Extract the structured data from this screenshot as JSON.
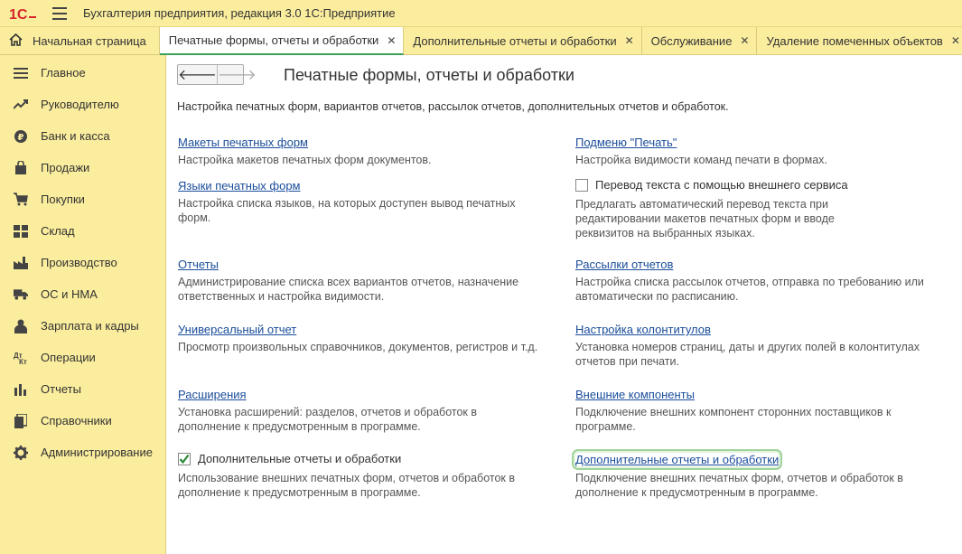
{
  "app": {
    "title": "Бухгалтерия предприятия, редакция 3.0 1С:Предприятие"
  },
  "tabs": [
    {
      "label": "Начальная страница"
    },
    {
      "label": "Печатные формы, отчеты и обработки"
    },
    {
      "label": "Дополнительные отчеты и обработки"
    },
    {
      "label": "Обслуживание"
    },
    {
      "label": "Удаление помеченных объектов"
    }
  ],
  "sidebar": {
    "items": [
      {
        "label": "Главное",
        "icon": "menu-lines-icon"
      },
      {
        "label": "Руководителю",
        "icon": "trend-icon"
      },
      {
        "label": "Банк и касса",
        "icon": "ruble-coin-icon"
      },
      {
        "label": "Продажи",
        "icon": "shopping-bag-icon"
      },
      {
        "label": "Покупки",
        "icon": "cart-icon"
      },
      {
        "label": "Склад",
        "icon": "warehouse-icon"
      },
      {
        "label": "Производство",
        "icon": "factory-icon"
      },
      {
        "label": "ОС и НМА",
        "icon": "truck-icon"
      },
      {
        "label": "Зарплата и кадры",
        "icon": "person-icon"
      },
      {
        "label": "Операции",
        "icon": "debit-credit-icon"
      },
      {
        "label": "Отчеты",
        "icon": "bar-chart-icon"
      },
      {
        "label": "Справочники",
        "icon": "books-icon"
      },
      {
        "label": "Администрирование",
        "icon": "gear-icon"
      }
    ]
  },
  "page": {
    "title": "Печатные формы, отчеты и обработки",
    "description": "Настройка печатных форм, вариантов отчетов, рассылок отчетов, дополнительных отчетов и обработок."
  },
  "left": {
    "print_layouts": {
      "link": "Макеты печатных форм",
      "desc": "Настройка макетов печатных форм документов."
    },
    "print_languages": {
      "link": "Языки печатных форм",
      "desc1": "Настройка списка языков, на которых доступен вывод печатных",
      "desc2": "форм."
    },
    "reports": {
      "link": "Отчеты",
      "desc1": "Администрирование списка всех вариантов отчетов, назначение",
      "desc2": "ответственных и настройка видимости."
    },
    "universal_report": {
      "link": "Универсальный отчет",
      "desc": "Просмотр произвольных справочников, документов, регистров и т.д."
    },
    "extensions": {
      "link": "Расширения",
      "desc1": "Установка расширений: разделов, отчетов и обработок в",
      "desc2": "дополнение к предусмотренным в программе."
    },
    "additional_reports": {
      "label": "Дополнительные отчеты и обработки",
      "checked": true,
      "desc1": "Использование внешних печатных форм, отчетов и обработок в",
      "desc2": "дополнение к предусмотренным в программе."
    }
  },
  "right": {
    "print_submenu": {
      "link": "Подменю \"Печать\"",
      "desc": "Настройка видимости команд печати в формах."
    },
    "translation": {
      "label": "Перевод текста с помощью внешнего сервиса",
      "checked": false,
      "desc1": "Предлагать автоматический перевод текста при",
      "desc2": "редактировании макетов печатных форм и вводе",
      "desc3": "реквизитов на выбранных языках."
    },
    "mailings": {
      "link": "Рассылки отчетов",
      "desc1": "Настройка списка рассылок отчетов, отправка по требованию или",
      "desc2": "автоматически по расписанию."
    },
    "headers_footers": {
      "link": "Настройка колонтитулов",
      "desc1": "Установка номеров страниц, даты и других полей в колонтитулах",
      "desc2": "отчетов при печати."
    },
    "external_components": {
      "link": "Внешние компоненты",
      "desc1": "Подключение внешних компонент сторонних поставщиков к",
      "desc2": "программе."
    },
    "additional_reports": {
      "link": "Дополнительные отчеты и обработки",
      "desc1": "Подключение внешних печатных форм, отчетов и обработок в",
      "desc2": "дополнение к предусмотренным в программе."
    }
  },
  "colors": {
    "panel": "#fbed9e",
    "link": "#1a4d9a",
    "active_tab_underline": "#3aa05a",
    "logo_red": "#d6262b"
  }
}
